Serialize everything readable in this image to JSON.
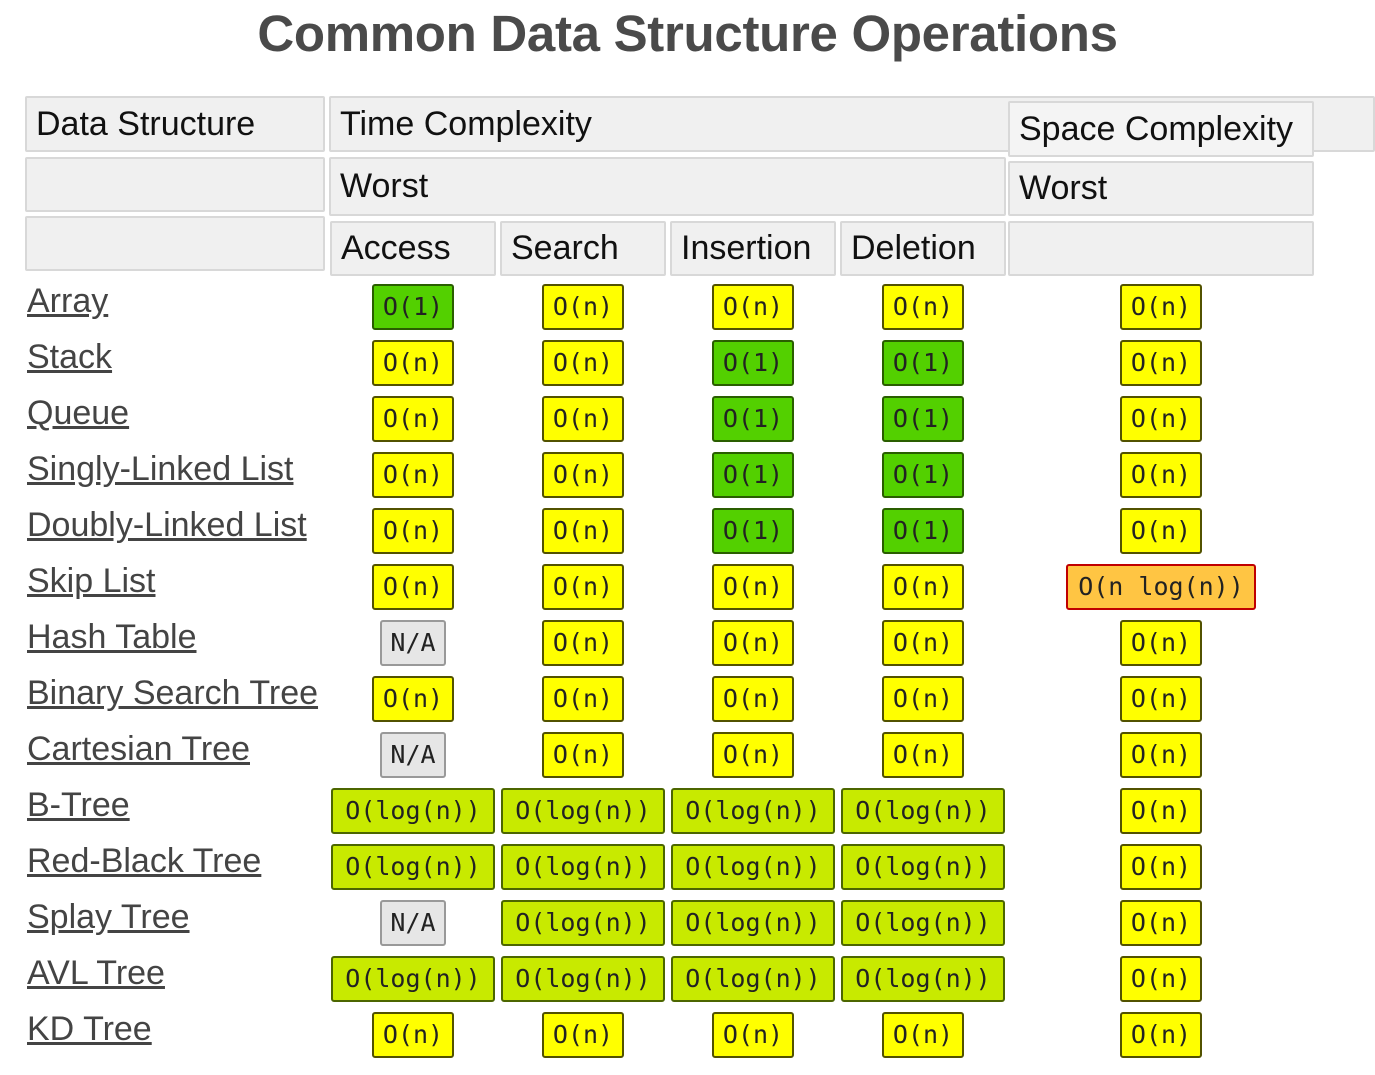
{
  "title": "Common Data Structure Operations",
  "header": {
    "data_structure": "Data Structure",
    "time_complexity": "Time Complexity",
    "space_complexity": "Space Complexity",
    "time_worst": "Worst",
    "space_worst": "Worst",
    "access": "Access",
    "search": "Search",
    "insertion": "Insertion",
    "deletion": "Deletion"
  },
  "complexity_colors": {
    "O(1)": "#53d000",
    "O(log(n))": "#c8ea00",
    "O(n)": "#ffff00",
    "O(n log(n))": "#ffc543",
    "N/A": "#e6e6e6"
  },
  "rows": [
    {
      "name": "Array",
      "access": "O(1)",
      "search": "O(n)",
      "insertion": "O(n)",
      "deletion": "O(n)",
      "space": "O(n)"
    },
    {
      "name": "Stack",
      "access": "O(n)",
      "search": "O(n)",
      "insertion": "O(1)",
      "deletion": "O(1)",
      "space": "O(n)"
    },
    {
      "name": "Queue",
      "access": "O(n)",
      "search": "O(n)",
      "insertion": "O(1)",
      "deletion": "O(1)",
      "space": "O(n)"
    },
    {
      "name": "Singly-Linked List",
      "access": "O(n)",
      "search": "O(n)",
      "insertion": "O(1)",
      "deletion": "O(1)",
      "space": "O(n)"
    },
    {
      "name": "Doubly-Linked List",
      "access": "O(n)",
      "search": "O(n)",
      "insertion": "O(1)",
      "deletion": "O(1)",
      "space": "O(n)"
    },
    {
      "name": "Skip List",
      "access": "O(n)",
      "search": "O(n)",
      "insertion": "O(n)",
      "deletion": "O(n)",
      "space": "O(n log(n))"
    },
    {
      "name": "Hash Table",
      "access": "N/A",
      "search": "O(n)",
      "insertion": "O(n)",
      "deletion": "O(n)",
      "space": "O(n)"
    },
    {
      "name": "Binary Search Tree",
      "access": "O(n)",
      "search": "O(n)",
      "insertion": "O(n)",
      "deletion": "O(n)",
      "space": "O(n)"
    },
    {
      "name": "Cartesian Tree",
      "access": "N/A",
      "search": "O(n)",
      "insertion": "O(n)",
      "deletion": "O(n)",
      "space": "O(n)"
    },
    {
      "name": "B-Tree",
      "access": "O(log(n))",
      "search": "O(log(n))",
      "insertion": "O(log(n))",
      "deletion": "O(log(n))",
      "space": "O(n)"
    },
    {
      "name": "Red-Black Tree",
      "access": "O(log(n))",
      "search": "O(log(n))",
      "insertion": "O(log(n))",
      "deletion": "O(log(n))",
      "space": "O(n)"
    },
    {
      "name": "Splay Tree",
      "access": "N/A",
      "search": "O(log(n))",
      "insertion": "O(log(n))",
      "deletion": "O(log(n))",
      "space": "O(n)"
    },
    {
      "name": "AVL Tree",
      "access": "O(log(n))",
      "search": "O(log(n))",
      "insertion": "O(log(n))",
      "deletion": "O(log(n))",
      "space": "O(n)"
    },
    {
      "name": "KD Tree",
      "access": "O(n)",
      "search": "O(n)",
      "insertion": "O(n)",
      "deletion": "O(n)",
      "space": "O(n)"
    }
  ]
}
